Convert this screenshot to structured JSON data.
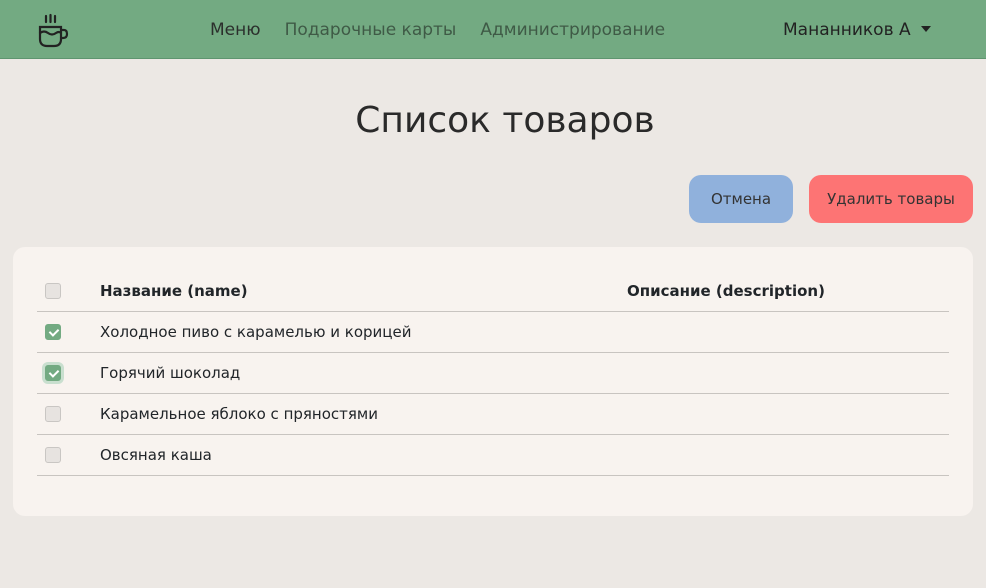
{
  "nav": {
    "logo_icon": "coffee-cup-icon",
    "links": [
      {
        "label": "Меню",
        "active": true
      },
      {
        "label": "Подарочные карты",
        "active": false
      },
      {
        "label": "Администрирование",
        "active": false
      }
    ],
    "user": "Мананников А"
  },
  "page": {
    "title": "Список товаров"
  },
  "actions": {
    "cancel_label": "Отмена",
    "delete_label": "Удалить товары"
  },
  "table": {
    "headers": {
      "name": "Название (name)",
      "description": "Описание (description)"
    },
    "rows": [
      {
        "name": "Холодное пиво с карамелью и корицей",
        "description": "",
        "checked": true
      },
      {
        "name": "Горячий шоколад",
        "description": "",
        "checked": true
      },
      {
        "name": "Карамельное яблоко с пряностями",
        "description": "",
        "checked": false
      },
      {
        "name": "Овсяная каша",
        "description": "",
        "checked": false
      }
    ]
  },
  "colors": {
    "navbar": "#73aa82",
    "cancel": "#90b1dc",
    "delete": "#fd7474",
    "check": "#73aa82"
  }
}
